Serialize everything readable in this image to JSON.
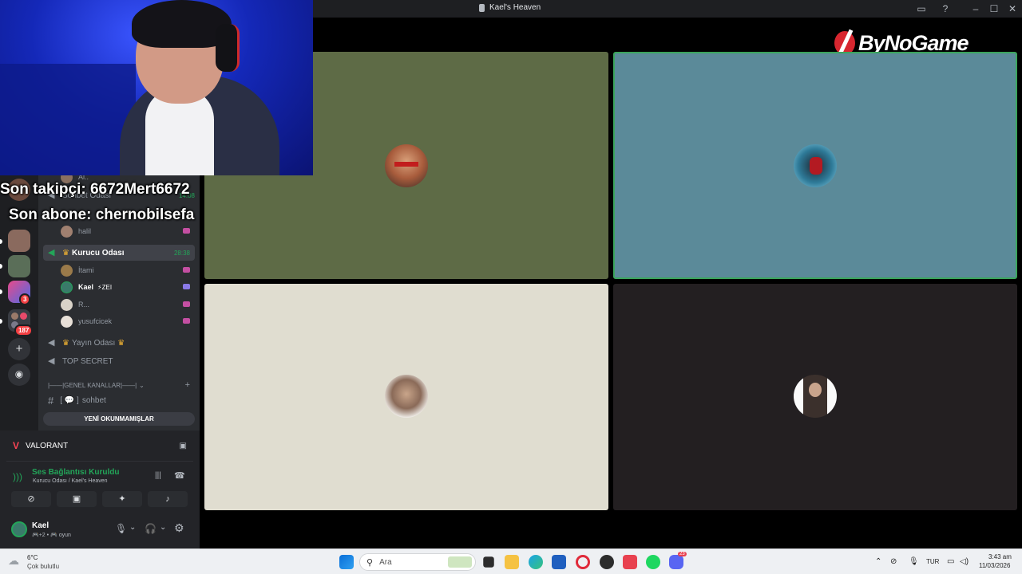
{
  "window": {
    "title": "Kael's Heaven"
  },
  "overlay": {
    "last_follower": "Son takipçi: 6672Mert6672",
    "last_sub": "Son abone: chernobilsefa",
    "logo": "ByNoGame"
  },
  "channels": {
    "partial_top_user": "Al..",
    "sohbet_odasi": "Sohbet Odası",
    "sohbet_time": "14:08",
    "halil": "halil",
    "kurucu_odasi": "Kurucu Odası",
    "kurucu_time": "28:38",
    "users": [
      "İtami",
      "Kael",
      "R...",
      "yusufcicek"
    ],
    "kael_tag": "⚡ZEI",
    "yayin_odasi": "Yayın Odası",
    "top_secret": "TOP SECRET",
    "genel_category": "|——|GENEL KANALLAR|——|",
    "sohbet_channel": "sohbet",
    "new_unreads": "YENİ OKUNMAMIŞLAR"
  },
  "servers": {
    "badge_3": "3",
    "badge_187": "187"
  },
  "panel": {
    "game": "VALORANT",
    "voice_status": "Ses Bağlantısı Kuruldu",
    "voice_location": "Kurucu Odası / Kael's Heaven",
    "user_name": "Kael",
    "user_status": "🎮+2 • 🎮 oyun"
  },
  "taskbar": {
    "weather_temp": "6°C",
    "weather_desc": "Çok bulutlu",
    "search_placeholder": "Ara",
    "lang": "TUR",
    "time": "3:43 am",
    "date": "11/03/2026",
    "discord_badge": "23"
  },
  "colors": {
    "tile_green": "#5e6b46",
    "tile_blue": "#5b8a99",
    "tile_beige": "#e0ddd0",
    "tile_dark": "#231f21",
    "speaking_border": "#3ba55c",
    "voice_green": "#23a559"
  }
}
